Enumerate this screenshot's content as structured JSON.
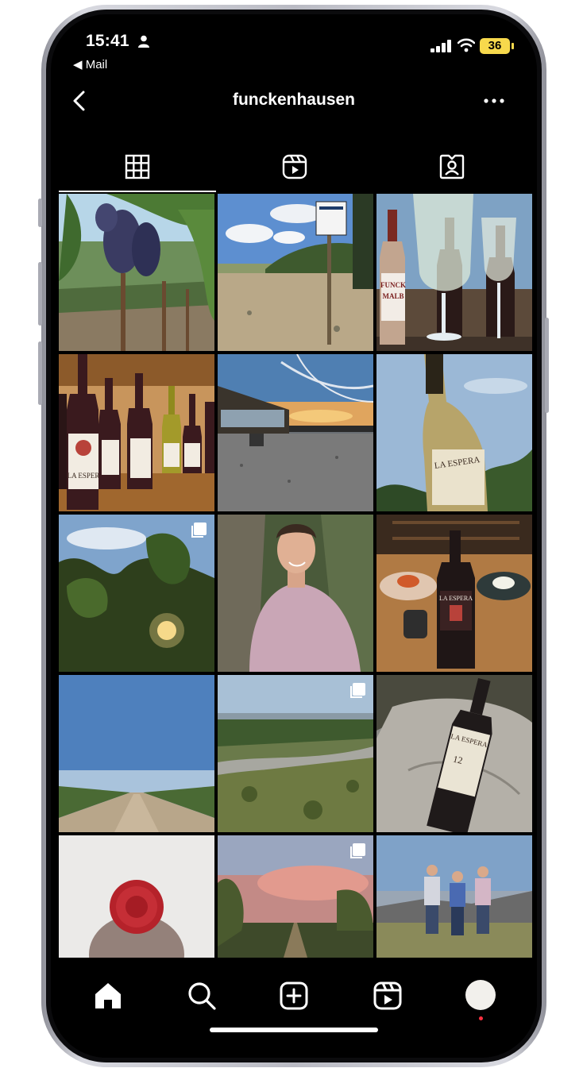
{
  "status_bar": {
    "time": "15:41",
    "back_app": "◀ Mail",
    "battery": "36"
  },
  "header": {
    "username": "funckenhausen"
  },
  "tabs": [
    {
      "name": "posts",
      "icon": "grid-icon",
      "active": true
    },
    {
      "name": "reels",
      "icon": "reels-icon",
      "active": false
    },
    {
      "name": "tagged",
      "icon": "tagged-icon",
      "active": false
    }
  ],
  "posts": [
    {
      "subject": "grapes on the vine",
      "multi": false
    },
    {
      "subject": "vineyard with sign",
      "multi": false
    },
    {
      "subject": "wine bottles and glasses",
      "multi": false,
      "labels": [
        "FUNCK",
        "MALB"
      ]
    },
    {
      "subject": "La Espera bottles on shelf",
      "multi": false,
      "labels": [
        "LA ESPER"
      ]
    },
    {
      "subject": "winery at sunset",
      "multi": false
    },
    {
      "subject": "La Espera white wine bottle",
      "multi": false,
      "labels": [
        "LA ESPERA"
      ]
    },
    {
      "subject": "vine leaves against sun",
      "multi": true
    },
    {
      "subject": "man in pink shirt",
      "multi": false
    },
    {
      "subject": "dinner table with red wine",
      "multi": false,
      "labels": [
        "LA ESPERA"
      ]
    },
    {
      "subject": "vineyard road",
      "multi": false
    },
    {
      "subject": "river valley",
      "multi": true
    },
    {
      "subject": "La Espera bottle on rock",
      "multi": false,
      "labels": [
        "LA ESPERA",
        "12"
      ]
    },
    {
      "subject": "bottle top with red seal",
      "multi": false
    },
    {
      "subject": "pink sky over vines",
      "multi": true
    },
    {
      "subject": "three men in field",
      "multi": false
    }
  ],
  "bottom_nav": [
    "home-icon",
    "search-icon",
    "new-post-icon",
    "reels-icon",
    "profile-avatar"
  ],
  "colors": {
    "background": "#000000",
    "text": "#ffffff",
    "notification": "#ff3040",
    "battery": "#f7d94c"
  }
}
